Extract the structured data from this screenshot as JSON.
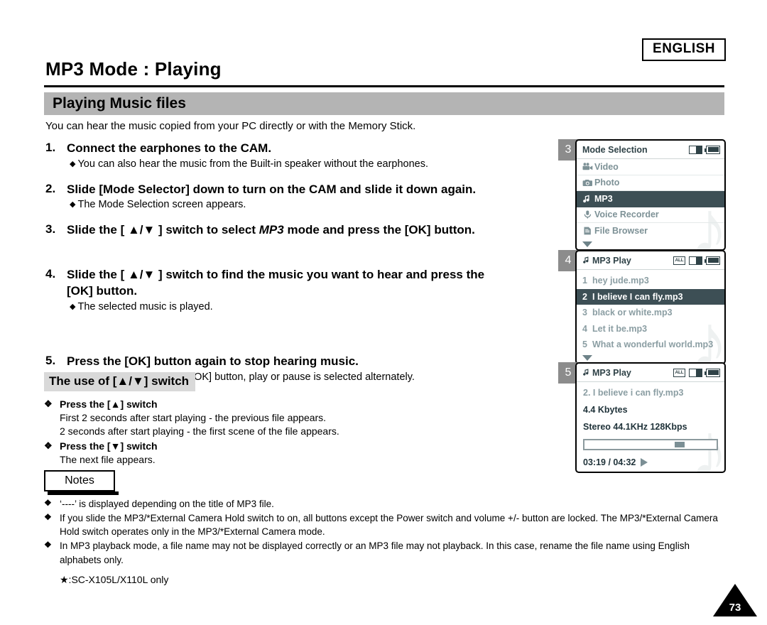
{
  "header": {
    "language_badge": "ENGLISH",
    "page_title": "MP3 Mode : Playing",
    "section_title": "Playing Music files",
    "intro": "You can hear the music copied from your PC directly or with the Memory Stick."
  },
  "steps": [
    {
      "num": "1.",
      "head": "Connect the earphones to the CAM.",
      "sub": "You can also hear the music from the Built-in speaker without the earphones."
    },
    {
      "num": "2.",
      "head": "Slide [Mode Selector] down to turn on the CAM and slide it down again.",
      "sub": "The Mode Selection screen appears."
    },
    {
      "num": "3.",
      "head_pre": "Slide the [ ▲/▼ ] switch to select ",
      "head_italic": "MP3",
      "head_post": " mode and press the [OK] button.",
      "sub": ""
    },
    {
      "num": "4.",
      "head": "Slide the [ ▲/▼ ] switch to find the music you want to hear and press the [OK] button.",
      "sub": "The selected music is played."
    },
    {
      "num": "5.",
      "head": "Press the [OK] button again to stop hearing music.",
      "sub": "Each time you press the [OK] button, play or pause is selected alternately."
    }
  ],
  "use_of_switch": {
    "heading": "The use of [▲/▼] switch",
    "items": [
      {
        "mark": "❖",
        "bold": "Press the [▲] switch",
        "lines": [
          "First 2 seconds after start playing - the previous file appears.",
          "2 seconds after start playing - the first scene of the file appears."
        ]
      },
      {
        "mark": "❖",
        "bold": "Press the [▼] switch",
        "lines": [
          "The next file appears."
        ]
      }
    ]
  },
  "notes": {
    "tab_label": "Notes",
    "mark": "❖",
    "items": [
      "‘----’ is displayed depending on the title of MP3 file.",
      "If you slide the MP3/*External Camera Hold switch to on, all buttons except the Power switch and volume +/- button are locked. The MP3/*External Camera Hold switch operates only in the MP3/*External Camera mode.",
      "In MP3 playback mode, a file name may not be displayed correctly or an MP3 file may not playback. In this case, rename the file name using English alphabets only."
    ],
    "footnote": "★:SC-X105L/X110L only"
  },
  "page_number": "73",
  "screens": [
    {
      "badge": "3",
      "title": "Mode Selection",
      "icons": [
        "memory-icon",
        "battery-icon"
      ],
      "menu": [
        {
          "icon": "camcorder-icon",
          "label": "Video",
          "selected": false
        },
        {
          "icon": "camera-icon",
          "label": "Photo",
          "selected": false
        },
        {
          "icon": "music-note-icon",
          "label": "MP3",
          "selected": true
        },
        {
          "icon": "microphone-icon",
          "label": "Voice Recorder",
          "selected": false
        },
        {
          "icon": "document-icon",
          "label": "File Browser",
          "selected": false
        }
      ]
    },
    {
      "badge": "4",
      "title": "MP3 Play",
      "title_icon": "music-note-icon",
      "icons": [
        "repeat-all-icon",
        "memory-icon",
        "battery-icon"
      ],
      "repeat_label": "ALL",
      "tracks": [
        {
          "no": "1",
          "name": "hey jude.mp3",
          "selected": false
        },
        {
          "no": "2",
          "name": "I believe I can fly.mp3",
          "selected": true
        },
        {
          "no": "3",
          "name": "black or white.mp3",
          "selected": false
        },
        {
          "no": "4",
          "name": "Let it be.mp3",
          "selected": false
        },
        {
          "no": "5",
          "name": "What a wonderful world.mp3",
          "selected": false
        }
      ]
    },
    {
      "badge": "5",
      "title": "MP3 Play",
      "title_icon": "music-note-icon",
      "icons": [
        "repeat-all-icon",
        "memory-icon",
        "battery-icon"
      ],
      "repeat_label": "ALL",
      "now_playing": "2.  I believe i can fly.mp3",
      "file_size": "4.4 Kbytes",
      "audio_format": "Stereo 44.1KHz 128Kbps",
      "progress_percent": 73,
      "time": "03:19 / 04:32"
    }
  ]
}
